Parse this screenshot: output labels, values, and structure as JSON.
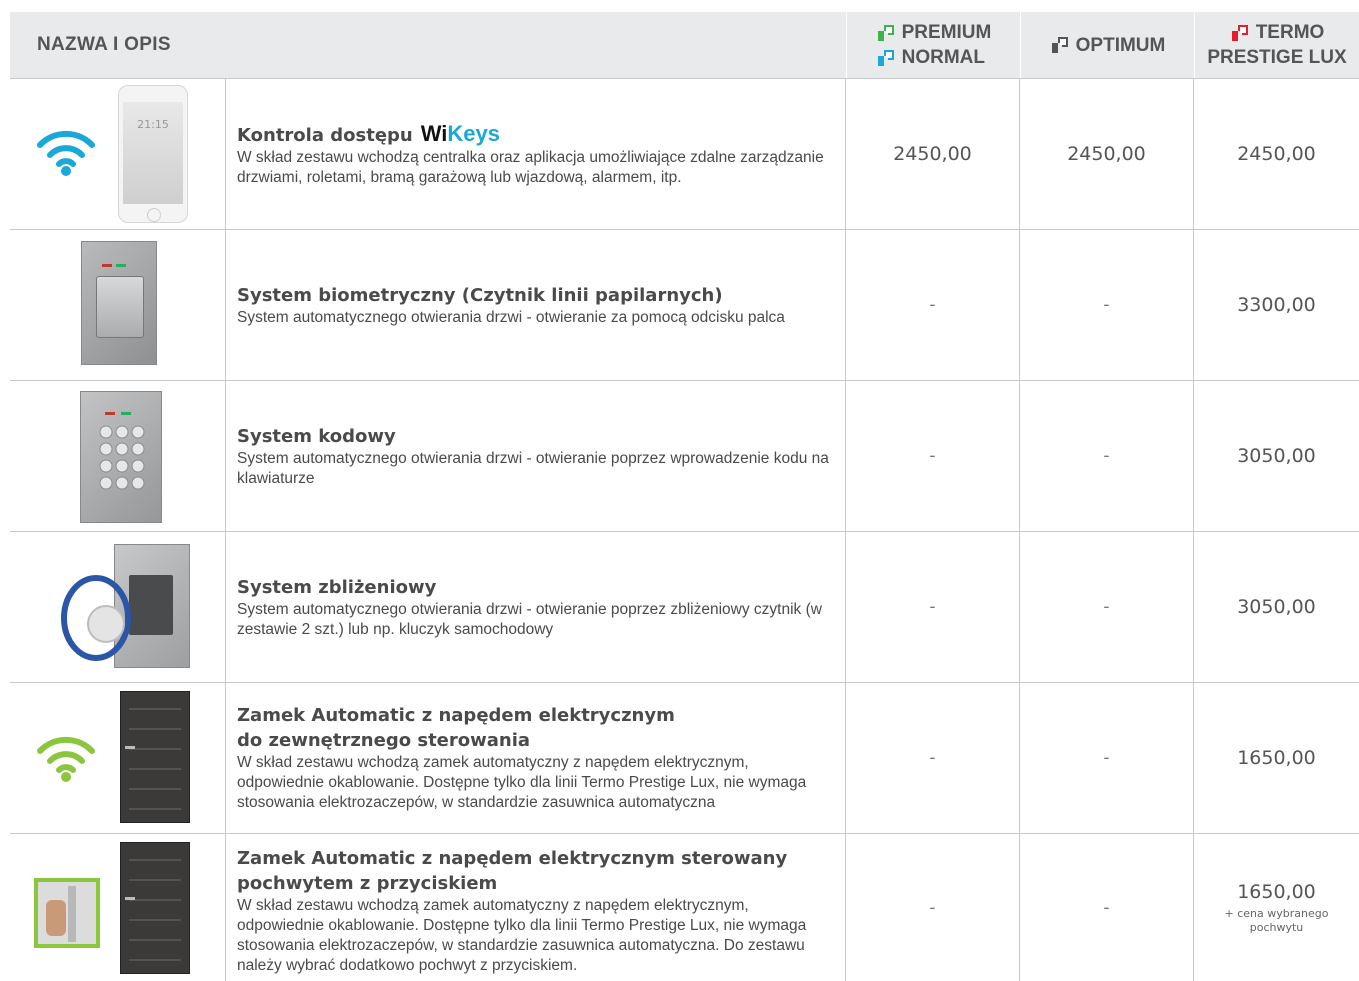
{
  "header": {
    "name_col": "NAZWA I OPIS",
    "col1": [
      "PREMIUM",
      "NORMAL"
    ],
    "col2": "OPTIMUM",
    "col3": [
      "TERMO",
      "PRESTIGE LUX"
    ]
  },
  "colors": {
    "premium_logo": "#3db34a",
    "normal_logo": "#1aa7d9",
    "optimum_logo": "#555555",
    "termo_logo": "#e31d2b",
    "wifi_blue": "#1aa7d9",
    "wifi_green": "#8cc63f"
  },
  "rows": [
    {
      "title": "Kontrola dostępu",
      "brand_wi": "Wi",
      "brand_keys": "Keys",
      "desc": "W skład zestawu wchodzą centralka oraz aplikacja umożliwiające zdalne zarządzanie drzwiami, roletami, bramą garażową lub wjazdową, alarmem, itp.",
      "phone_time": "21:15",
      "prices": [
        "2450,00",
        "2450,00",
        "2450,00"
      ]
    },
    {
      "title": "System biometryczny (Czytnik linii papilarnych)",
      "desc": "System automatycznego otwierania drzwi - otwieranie za pomocą odcisku palca",
      "prices": [
        "-",
        "-",
        "3300,00"
      ]
    },
    {
      "title": "System kodowy",
      "desc": "System automatycznego otwierania drzwi - otwieranie poprzez wprowadzenie kodu na klawiaturze",
      "prices": [
        "-",
        "-",
        "3050,00"
      ]
    },
    {
      "title": "System zbliżeniowy",
      "desc": "System automatycznego otwierania drzwi - otwieranie poprzez zbliżeniowy czytnik (w zestawie 2 szt.) lub np. kluczyk samochodowy",
      "prices": [
        "-",
        "-",
        "3050,00"
      ]
    },
    {
      "title_lines": [
        "Zamek Automatic z napędem elektrycznym",
        "do zewnętrznego sterowania"
      ],
      "desc": "W skład zestawu wchodzą zamek automatyczny z napędem elektrycznym, odpowiednie okablowanie. Dostępne tylko dla linii Termo Prestige Lux, nie wymaga stosowania elektrozaczepów, w standardzie zasuwnica automatyczna",
      "prices": [
        "-",
        "-",
        "1650,00"
      ]
    },
    {
      "title_lines": [
        "Zamek Automatic z napędem elektrycznym sterowany",
        "pochwytem z przyciskiem"
      ],
      "desc": "W skład zestawu wchodzą zamek automatyczny z napędem elektrycznym, odpowiednie okablowanie. Dostępne tylko dla linii Termo Prestige Lux, nie wymaga stosowania elektrozaczepów, w standardzie zasuwnica automatyczna. Do zestawu należy wybrać dodatkowo pochwyt z przyciskiem.",
      "prices": [
        "-",
        "-",
        "1650,00"
      ],
      "price_note": "+ cena wybranego pochwytu"
    }
  ]
}
